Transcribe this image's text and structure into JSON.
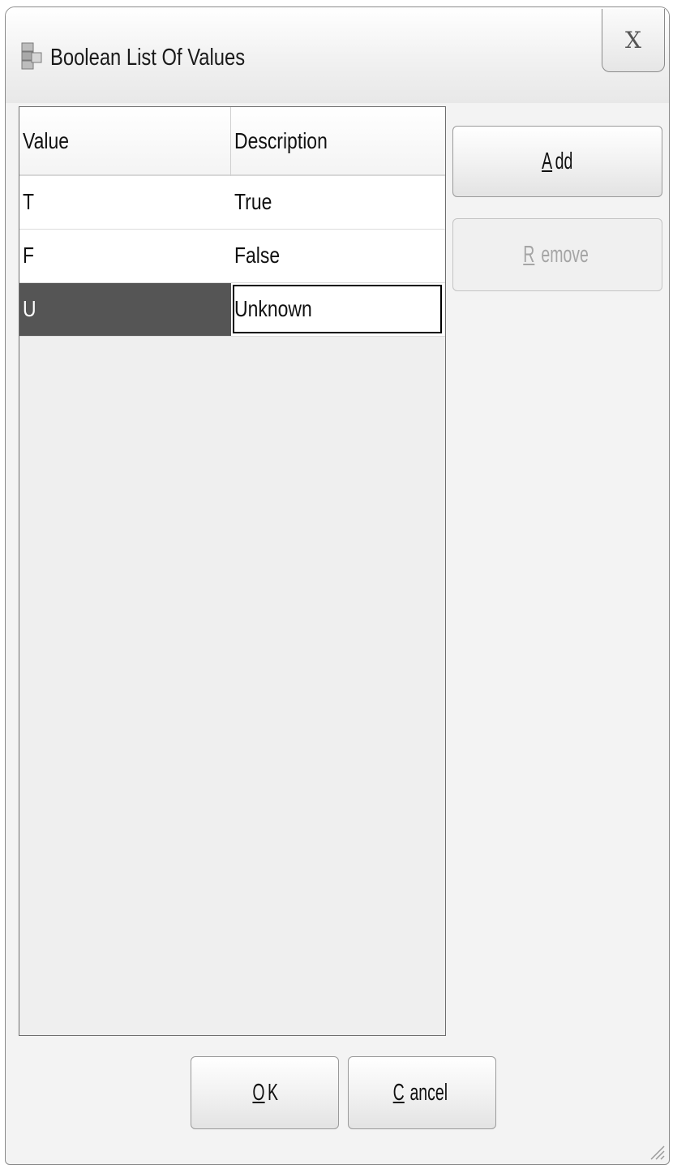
{
  "window": {
    "title": "Boolean List Of Values",
    "close_glyph": "X"
  },
  "table": {
    "columns": [
      "Value",
      "Description"
    ],
    "rows": [
      {
        "value": "T",
        "description": "True"
      },
      {
        "value": "F",
        "description": "False"
      },
      {
        "value": "U",
        "description": "Unknown"
      }
    ],
    "selected_row": 3
  },
  "buttons": {
    "add": {
      "mnemonic": "A",
      "rest": "dd"
    },
    "remove": {
      "mnemonic": "R",
      "rest": "emove"
    },
    "ok": {
      "mnemonic": "O",
      "rest": "K"
    },
    "cancel": {
      "mnemonic": "C",
      "rest": "ancel"
    }
  },
  "icons": {
    "app": "list-of-values-icon",
    "close": "close-icon",
    "resize": "resize-grip-icon"
  }
}
